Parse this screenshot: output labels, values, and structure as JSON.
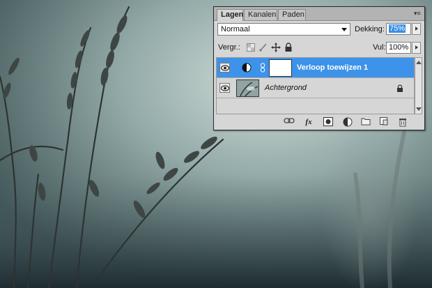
{
  "panel": {
    "tabs": [
      {
        "label": "Lagen"
      },
      {
        "label": "Kanalen"
      },
      {
        "label": "Paden"
      }
    ],
    "menu_glyph": "▾≡",
    "blend_mode": "Normaal",
    "opacity_label": "Dekking:",
    "opacity_value": "75%",
    "lock_label": "Vergr.:",
    "fill_label": "Vul:",
    "fill_value": "100%",
    "layers": [
      {
        "name": "Verloop toewijzen 1",
        "selected": true,
        "type": "adjustment"
      },
      {
        "name": "Achtergrond",
        "selected": false,
        "type": "image",
        "locked": true
      }
    ],
    "footer_icons": [
      "link-icon",
      "fx-icon",
      "mask-icon",
      "adjustment-layer-icon",
      "group-folder-icon",
      "new-layer-icon",
      "trash-icon"
    ],
    "fx_label": "fx"
  },
  "colors": {
    "selected_row": "#3d92ea",
    "panel_bg": "#d6d6d6",
    "tab_bar": "#b3b3b3"
  }
}
